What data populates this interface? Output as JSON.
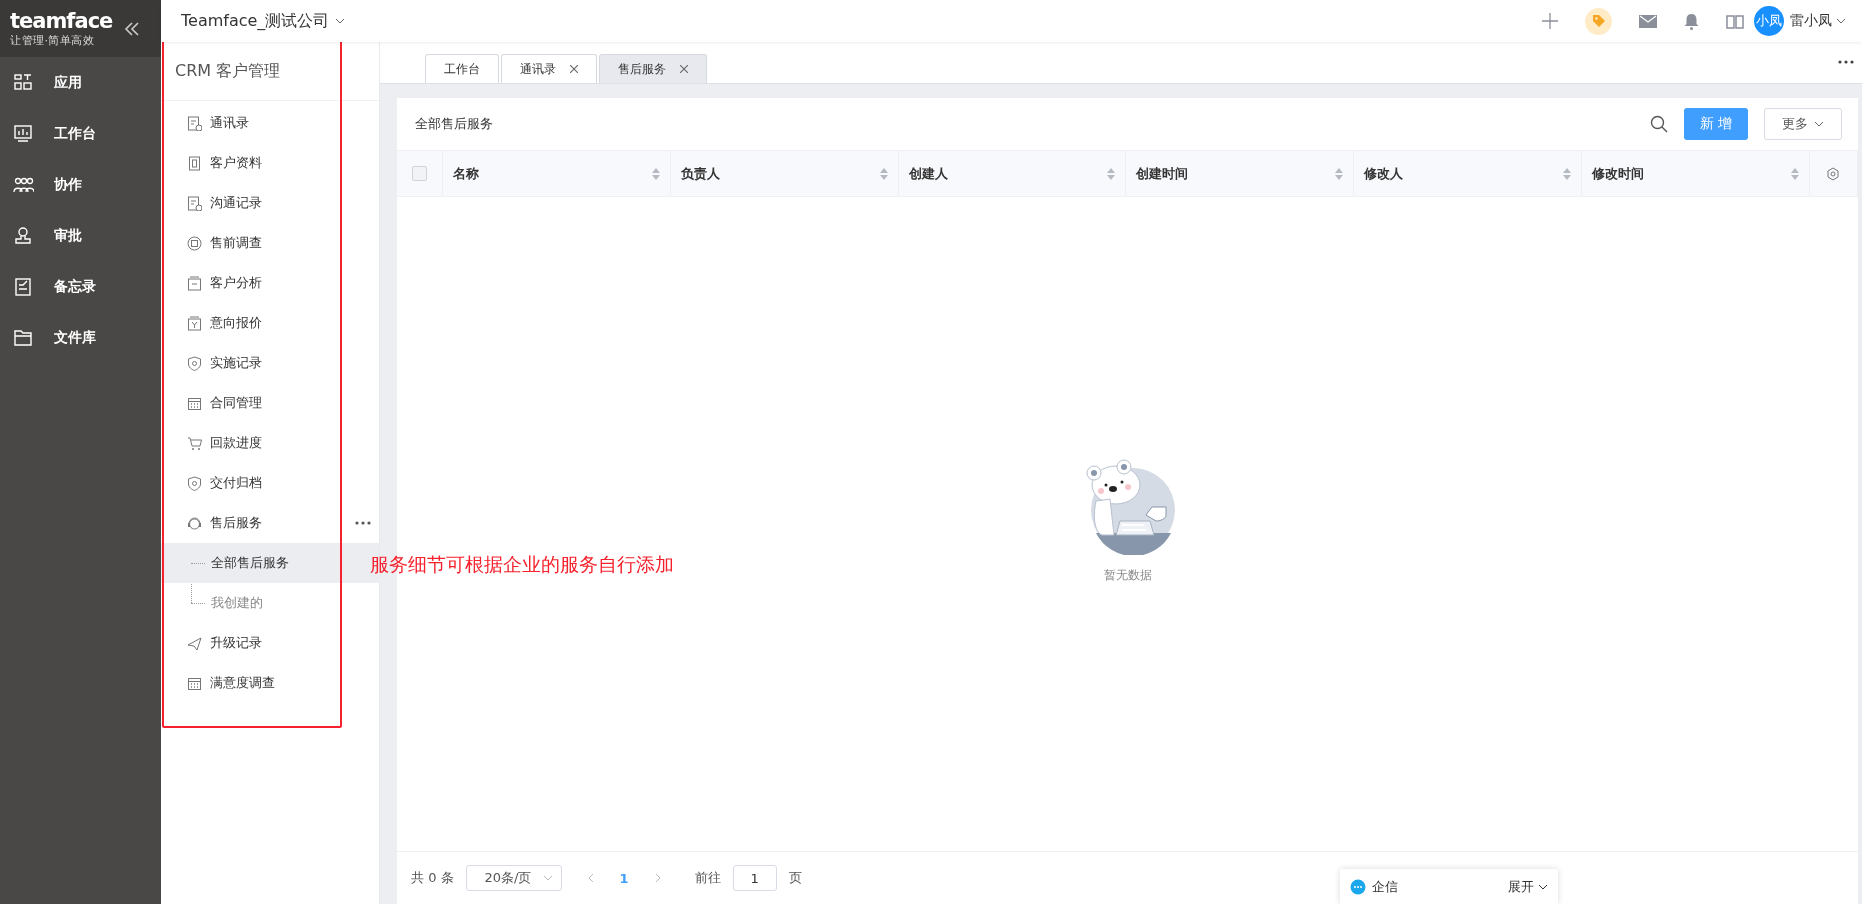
{
  "brand": {
    "logo": "teamface",
    "slogan": "让管理·简单高效"
  },
  "nav": [
    {
      "label": "应用"
    },
    {
      "label": "工作台"
    },
    {
      "label": "协作"
    },
    {
      "label": "审批"
    },
    {
      "label": "备忘录"
    },
    {
      "label": "文件库"
    }
  ],
  "company": "Teamface_测试公司",
  "user": {
    "avatar": "小凤",
    "name": "雷小凤"
  },
  "module": {
    "title": "CRM 客户管理",
    "items": [
      {
        "label": "通讯录",
        "selected": false
      },
      {
        "label": "客户资料",
        "selected": false
      },
      {
        "label": "沟通记录",
        "selected": false
      },
      {
        "label": "售前调查",
        "selected": false
      },
      {
        "label": "客户分析",
        "selected": false
      },
      {
        "label": "意向报价",
        "selected": false
      },
      {
        "label": "实施记录",
        "selected": false
      },
      {
        "label": "合同管理",
        "selected": false
      },
      {
        "label": "回款进度",
        "selected": false
      },
      {
        "label": "交付归档",
        "selected": false
      },
      {
        "label": "售后服务",
        "selected": false,
        "expanded": true,
        "children": [
          {
            "label": "全部售后服务",
            "selected": true
          },
          {
            "label": "我创建的",
            "selected": false
          }
        ]
      },
      {
        "label": "升级记录",
        "selected": false
      },
      {
        "label": "满意度调查",
        "selected": false
      }
    ]
  },
  "tabs": [
    {
      "label": "工作台",
      "closable": false,
      "selected": false
    },
    {
      "label": "通讯录",
      "closable": true,
      "selected": false
    },
    {
      "label": "售后服务",
      "closable": true,
      "selected": true
    }
  ],
  "list": {
    "title": "全部售后服务",
    "add_button": "新 增",
    "more_button": "更多",
    "columns": [
      "名称",
      "负责人",
      "创建人",
      "创建时间",
      "修改人",
      "修改时间"
    ],
    "empty_text": "暂无数据",
    "select_all_checked": false
  },
  "pagination": {
    "total": "共 0 条",
    "page_size": "20条/页",
    "current_page": "1",
    "goto_label": "前往",
    "goto_value": "1",
    "page_suffix": "页"
  },
  "chat": {
    "title": "企信",
    "toggle": "展开"
  },
  "annotation": "服务细节可根据企业的服务自行添加"
}
